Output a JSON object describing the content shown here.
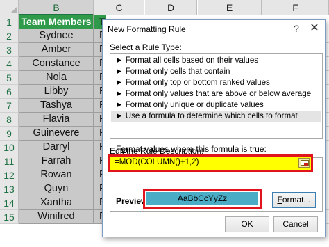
{
  "sheet": {
    "columns": [
      "B",
      "C",
      "D",
      "E",
      "F"
    ],
    "rows": [
      "1",
      "2",
      "3",
      "4",
      "5",
      "6",
      "7",
      "8",
      "9",
      "10",
      "11",
      "12",
      "13",
      "14",
      "15"
    ],
    "names": [
      "Team Members",
      "Sydnee",
      "Amber",
      "Constance",
      "Nola",
      "Libby",
      "Tashya",
      "Flavia",
      "Guinevere",
      "Darryl",
      "Farrah",
      "Rowan",
      "Quyn",
      "Xantha",
      "Winifred"
    ],
    "column_c_partial": [
      "T",
      "F",
      "F",
      "F",
      "F",
      "F",
      "F",
      "F",
      "F",
      "F",
      "F",
      "F",
      "F",
      "F",
      "F"
    ]
  },
  "dialog": {
    "title": "New Formatting Rule",
    "help": "?",
    "close": "✕",
    "rule_type_label_prefix": "",
    "rule_type_label_key": "S",
    "rule_type_label_rest": "elect a Rule Type:",
    "rule_types": [
      "► Format all cells based on their values",
      "► Format only cells that contain",
      "► Format only top or bottom ranked values",
      "► Format only values that are above or below average",
      "► Format only unique or duplicate values",
      "► Use a formula to determine which cells to format"
    ],
    "edit_label_key": "E",
    "edit_label_rest": "dit the Rule Description:",
    "formula_label_prefix": "F",
    "formula_label_key": "o",
    "formula_label_rest": "rmat values where this formula is true:",
    "formula_value": "=MOD(COLUMN()+1,2)",
    "preview_label": "Preview:",
    "preview_sample": "AaBbCcYyZz",
    "format_button_key": "F",
    "format_button_rest": "ormat...",
    "ok_button": "OK",
    "cancel_button": "Cancel"
  },
  "colors": {
    "header_green": "#2e9a4a",
    "name_cells_gray": "#c9c9c9",
    "highlight_red": "#e0141c",
    "formula_yellow": "#ffff00",
    "preview_fill": "#4bacc6"
  }
}
